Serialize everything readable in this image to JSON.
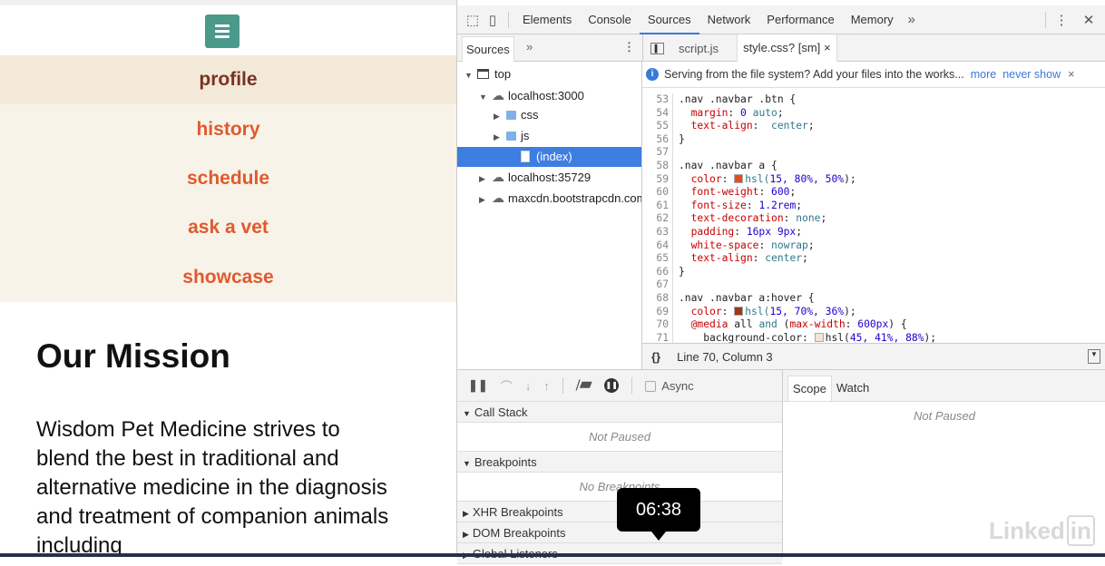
{
  "page": {
    "nav": [
      "profile",
      "history",
      "schedule",
      "ask a vet",
      "showcase"
    ],
    "active_nav": 0,
    "mission_title": "Our Mission",
    "mission_text": "Wisdom Pet Medicine strives to blend the best in traditional and alternative medicine in the diagnosis and treatment of companion animals including",
    "accent": "#4a9a8c",
    "link_color": "#e05a2e"
  },
  "devtools": {
    "tabs": [
      "Elements",
      "Console",
      "Sources",
      "Network",
      "Performance",
      "Memory"
    ],
    "active_tab": "Sources",
    "more": "»",
    "menu": "⋮",
    "close": "✕",
    "navigator": {
      "tab": "Sources",
      "more": "»",
      "menu": "⋮"
    },
    "tree": [
      {
        "label": "top",
        "arrow": "▼",
        "icon": "frame",
        "indent": 0
      },
      {
        "label": "localhost:3000",
        "arrow": "▼",
        "icon": "cloud",
        "indent": 1
      },
      {
        "label": "css",
        "arrow": "▶",
        "icon": "folder",
        "indent": 2
      },
      {
        "label": "js",
        "arrow": "▶",
        "icon": "folder",
        "indent": 2
      },
      {
        "label": "(index)",
        "arrow": "",
        "icon": "file",
        "indent": 3,
        "selected": true
      },
      {
        "label": "localhost:35729",
        "arrow": "▶",
        "icon": "cloud",
        "indent": 1
      },
      {
        "label": "maxcdn.bootstrapcdn.com",
        "arrow": "▶",
        "icon": "cloud",
        "indent": 1
      }
    ],
    "editor_tabs": [
      "script.js",
      "style.css? [sm]"
    ],
    "close_tab": "×",
    "info": {
      "text": "Serving from the file system? Add your files into the works...",
      "more": "more",
      "never": "never show",
      "close": "×"
    },
    "code": [
      {
        "n": 53,
        "t": [
          [
            "s",
            ".nav .navbar .btn {"
          ]
        ]
      },
      {
        "n": 54,
        "t": [
          [
            "s",
            "  "
          ],
          [
            "p",
            "margin"
          ],
          [
            "s",
            ": "
          ],
          [
            "v",
            "0"
          ],
          [
            "k",
            " auto"
          ],
          [
            "s",
            ";"
          ]
        ]
      },
      {
        "n": 55,
        "t": [
          [
            "s",
            "  "
          ],
          [
            "p",
            "text-align"
          ],
          [
            "s",
            ":  "
          ],
          [
            "k",
            "center"
          ],
          [
            "s",
            ";"
          ]
        ]
      },
      {
        "n": 56,
        "t": [
          [
            "s",
            "}"
          ]
        ]
      },
      {
        "n": 57,
        "t": []
      },
      {
        "n": 58,
        "t": [
          [
            "s",
            ".nav .navbar a {"
          ]
        ]
      },
      {
        "n": 59,
        "t": [
          [
            "s",
            "  "
          ],
          [
            "p",
            "color"
          ],
          [
            "s",
            ": "
          ],
          [
            "sw",
            "#e0501f"
          ],
          [
            "k",
            "hsl("
          ],
          [
            "v",
            "15, 80%, 50%"
          ],
          [
            "s",
            ");"
          ]
        ]
      },
      {
        "n": 60,
        "t": [
          [
            "s",
            "  "
          ],
          [
            "p",
            "font-weight"
          ],
          [
            "s",
            ": "
          ],
          [
            "v",
            "600"
          ],
          [
            "s",
            ";"
          ]
        ]
      },
      {
        "n": 61,
        "t": [
          [
            "s",
            "  "
          ],
          [
            "p",
            "font-size"
          ],
          [
            "s",
            ": "
          ],
          [
            "v",
            "1.2rem"
          ],
          [
            "s",
            ";"
          ]
        ]
      },
      {
        "n": 62,
        "t": [
          [
            "s",
            "  "
          ],
          [
            "p",
            "text-decoration"
          ],
          [
            "s",
            ": "
          ],
          [
            "k",
            "none"
          ],
          [
            "s",
            ";"
          ]
        ]
      },
      {
        "n": 63,
        "t": [
          [
            "s",
            "  "
          ],
          [
            "p",
            "padding"
          ],
          [
            "s",
            ": "
          ],
          [
            "v",
            "16px 9px"
          ],
          [
            "s",
            ";"
          ]
        ]
      },
      {
        "n": 64,
        "t": [
          [
            "s",
            "  "
          ],
          [
            "p",
            "white-space"
          ],
          [
            "s",
            ": "
          ],
          [
            "k",
            "nowrap"
          ],
          [
            "s",
            ";"
          ]
        ]
      },
      {
        "n": 65,
        "t": [
          [
            "s",
            "  "
          ],
          [
            "p",
            "text-align"
          ],
          [
            "s",
            ": "
          ],
          [
            "k",
            "center"
          ],
          [
            "s",
            ";"
          ]
        ]
      },
      {
        "n": 66,
        "t": [
          [
            "s",
            "}"
          ]
        ]
      },
      {
        "n": 67,
        "t": []
      },
      {
        "n": 68,
        "t": [
          [
            "s",
            ".nav .navbar a:hover {"
          ]
        ]
      },
      {
        "n": 69,
        "t": [
          [
            "s",
            "  "
          ],
          [
            "p",
            "color"
          ],
          [
            "s",
            ": "
          ],
          [
            "sw",
            "#9c3a17"
          ],
          [
            "k",
            "hsl("
          ],
          [
            "v",
            "15, 70%, 36%"
          ],
          [
            "s",
            ");"
          ]
        ]
      },
      {
        "n": 70,
        "t": [
          [
            "s",
            "  "
          ],
          [
            "p",
            "@media"
          ],
          [
            "s",
            " all "
          ],
          [
            "k",
            "and"
          ],
          [
            "s",
            " ("
          ],
          [
            "p",
            "max-width"
          ],
          [
            "s",
            ": "
          ],
          [
            "v",
            "600px"
          ],
          [
            "s",
            ") {"
          ]
        ]
      },
      {
        "n": 71,
        "t": [
          [
            "s",
            "    background-color: "
          ],
          [
            "sw",
            "#efe6d3"
          ],
          [
            "s",
            "hsl("
          ],
          [
            "v",
            "45, 41%, 88%"
          ],
          [
            "s",
            ");"
          ]
        ]
      }
    ],
    "status": {
      "braces": "{}",
      "position": "Line 70, Column 3"
    },
    "debugger": {
      "async": "Async",
      "sections": [
        {
          "title": "Call Stack",
          "open": true,
          "body": "Not Paused"
        },
        {
          "title": "Breakpoints",
          "open": true,
          "body": "No Breakpoints"
        },
        {
          "title": "XHR Breakpoints",
          "open": false
        },
        {
          "title": "DOM Breakpoints",
          "open": false
        },
        {
          "title": "Global Listeners",
          "open": false
        }
      ]
    },
    "scope": {
      "tabs": [
        "Scope",
        "Watch"
      ],
      "body": "Not Paused"
    }
  },
  "video": {
    "time": "06:38",
    "logo": "Linked",
    "logo_in": "in"
  }
}
